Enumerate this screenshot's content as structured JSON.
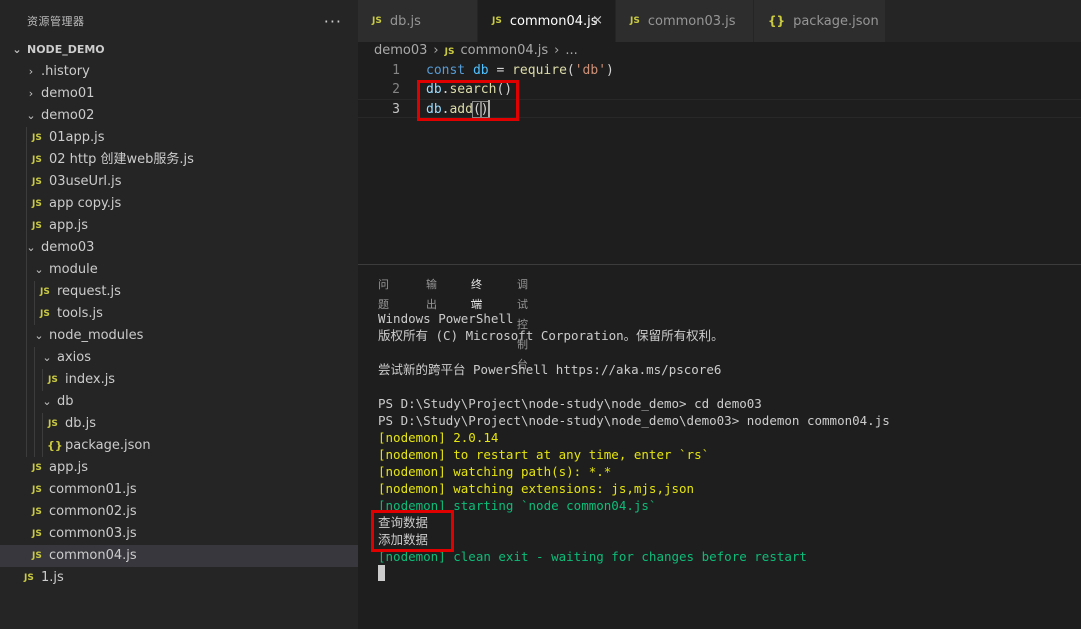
{
  "sidebar": {
    "title": "资源管理器",
    "more": "···",
    "root": "NODE_DEMO",
    "items": [
      {
        "label": ".history"
      },
      {
        "label": "demo01"
      },
      {
        "label": "demo02"
      },
      {
        "label": "01app.js"
      },
      {
        "label": "02 http 创建web服务.js"
      },
      {
        "label": "03useUrl.js"
      },
      {
        "label": "app copy.js"
      },
      {
        "label": "app.js"
      },
      {
        "label": "demo03"
      },
      {
        "label": "module"
      },
      {
        "label": "request.js"
      },
      {
        "label": "tools.js"
      },
      {
        "label": "node_modules"
      },
      {
        "label": "axios"
      },
      {
        "label": "index.js"
      },
      {
        "label": "db"
      },
      {
        "label": "db.js"
      },
      {
        "label": "package.json"
      },
      {
        "label": "app.js"
      },
      {
        "label": "common01.js"
      },
      {
        "label": "common02.js"
      },
      {
        "label": "common03.js"
      },
      {
        "label": "common04.js"
      },
      {
        "label": "1.js"
      }
    ],
    "icon_js": "JS",
    "icon_json": "{}"
  },
  "tabs": [
    {
      "label": "db.js",
      "icon": "JS"
    },
    {
      "label": "common04.js",
      "icon": "JS",
      "close": "×"
    },
    {
      "label": "common03.js",
      "icon": "JS"
    },
    {
      "label": "package.json",
      "icon": "{}"
    }
  ],
  "breadcrumb": {
    "folder": "demo03",
    "sep": "›",
    "icon": "JS",
    "file": "common04.js",
    "tail": "..."
  },
  "editor": {
    "line_numbers": [
      "1",
      "2",
      "3"
    ],
    "line1": {
      "kw": "const",
      "var": "db",
      "eq": " = ",
      "fn": "require",
      "open": "(",
      "str": "'db'",
      "close": ")"
    },
    "line2": {
      "obj": "db",
      "dot": ".",
      "method": "search",
      "parens": "()"
    },
    "line3": {
      "obj": "db",
      "dot": ".",
      "method": "add",
      "open": "(",
      "close": ")"
    }
  },
  "panel": {
    "tabs": [
      "问题",
      "输出",
      "终端",
      "调试控制台"
    ],
    "active_tab": "终端"
  },
  "terminal": {
    "lines": [
      "Windows PowerShell",
      "版权所有 (C) Microsoft Corporation。保留所有权利。",
      "",
      "尝试新的跨平台 PowerShell https://aka.ms/pscore6",
      "",
      "PS D:\\Study\\Project\\node-study\\node_demo> cd demo03",
      "PS D:\\Study\\Project\\node-study\\node_demo\\demo03> nodemon common04.js",
      "[nodemon] 2.0.14",
      "[nodemon] to restart at any time, enter `rs`",
      "[nodemon] watching path(s): *.*",
      "[nodemon] watching extensions: js,mjs,json",
      "[nodemon] starting `node common04.js`",
      "查询数据",
      "添加数据",
      "[nodemon] clean exit - waiting for changes before restart"
    ]
  },
  "colors": {
    "highlight_box": "#e00000",
    "nodemon_yellow": "#e5e510",
    "nodemon_green": "#0dbc79"
  }
}
